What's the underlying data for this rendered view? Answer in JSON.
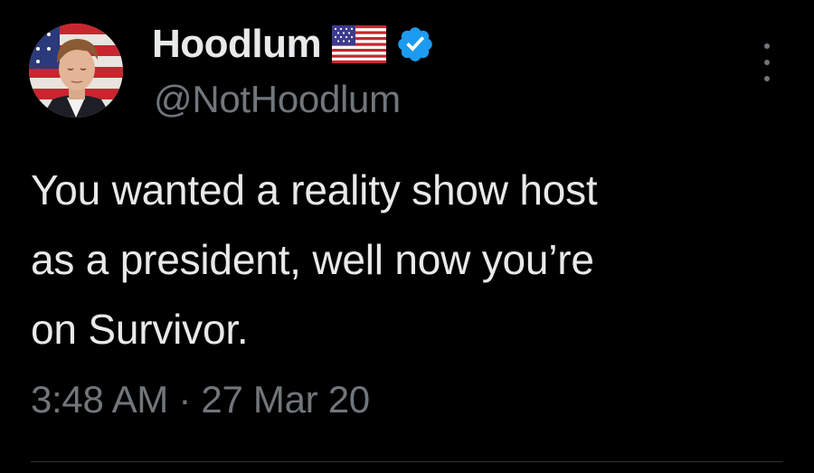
{
  "tweet": {
    "author": {
      "display_name": "Hoodlum",
      "handle": "@NotHoodlum",
      "name_emoji": "us-flag-icon",
      "verified": true,
      "verified_color": "#1d9bf0"
    },
    "text_lines": [
      "You wanted a reality show host",
      "as a president, well now you’re",
      "on Survivor."
    ],
    "timestamp": "3:48 AM · 27 Mar 20",
    "more_icon": "more-vertical-icon"
  },
  "colors": {
    "background": "#000000",
    "primary_text": "#e7e9ea",
    "secondary_text": "#71767b",
    "divider": "#2f3336"
  }
}
